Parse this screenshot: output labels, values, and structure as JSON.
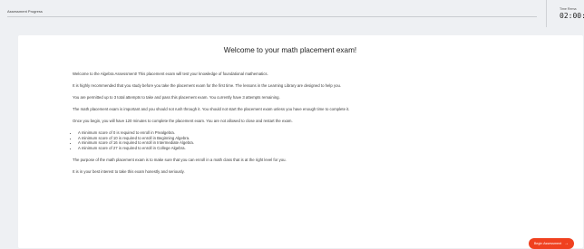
{
  "header": {
    "progress_label": "Assessment Progress",
    "progress_fraction": 0,
    "timer_label": "Time Rema",
    "timer_value": "02:00:"
  },
  "card": {
    "title": "Welcome to your math placement exam!",
    "paragraphs": [
      "Welcome to the Algebra Assessment! This placement exam will test your knowledge of foundational mathematics.",
      "It is highly recommended that you study before you take the placement exam for the first time. The lessons in the Learning Library are designed to help you.",
      "You are permitted up to 3 total attempts to take and pass this placement exam. You currently have 3 attempts remaining.",
      "The math placement exam is important and you should not rush through it. You should not start the placement exam unless you have enough time to complete it.",
      "Once you begin, you will have 120 minutes to complete the placement exam. You are not allowed to close and restart the exam."
    ],
    "bullets": [
      "A minimum score of 0 is required to enroll in Prealgebra.",
      "A minimum score of 10 is required to enroll in Beginning Algebra.",
      "A minimum score of 16 is required to enroll in Intermediate Algebra.",
      "A minimum score of 27 is required to enroll in College Algebra."
    ],
    "closing": [
      "The purpose of the math placement exam is to make sure that you can enroll in a math class that is at the right level for you.",
      "It is in your best interest to take this exam honestly and seriously."
    ]
  },
  "actions": {
    "begin_label": "Begin Assessment",
    "begin_icon": "arrow-right-icon",
    "accent_color": "#f0411f"
  }
}
